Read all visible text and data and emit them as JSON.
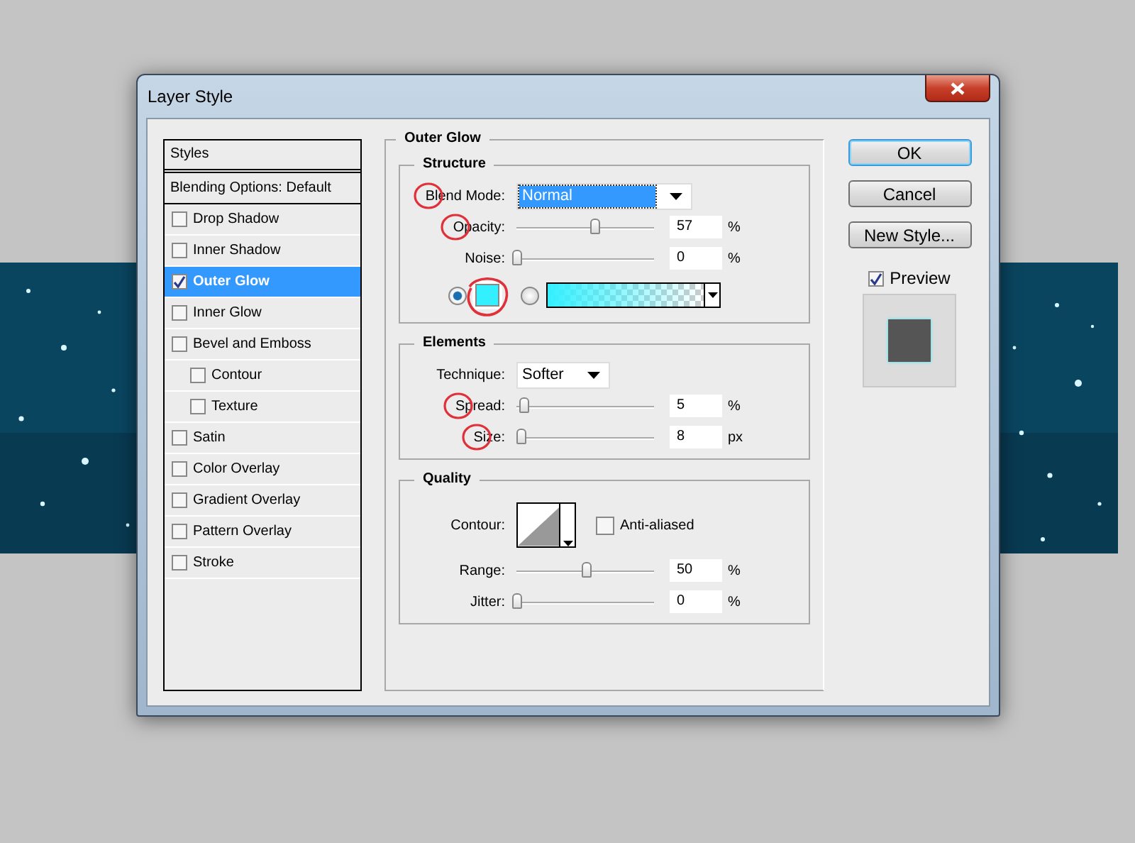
{
  "window": {
    "title": "Layer Style"
  },
  "styles_list": {
    "header": "Styles",
    "blending_options": "Blending Options: Default",
    "items": [
      {
        "label": "Drop Shadow",
        "checked": false,
        "selected": false
      },
      {
        "label": "Inner Shadow",
        "checked": false,
        "selected": false
      },
      {
        "label": "Outer Glow",
        "checked": true,
        "selected": true
      },
      {
        "label": "Inner Glow",
        "checked": false,
        "selected": false
      },
      {
        "label": "Bevel and Emboss",
        "checked": false,
        "selected": false,
        "children": [
          {
            "label": "Contour",
            "checked": false,
            "selected": false
          },
          {
            "label": "Texture",
            "checked": false,
            "selected": false
          }
        ]
      },
      {
        "label": "Satin",
        "checked": false,
        "selected": false
      },
      {
        "label": "Color Overlay",
        "checked": false,
        "selected": false
      },
      {
        "label": "Gradient Overlay",
        "checked": false,
        "selected": false
      },
      {
        "label": "Pattern Overlay",
        "checked": false,
        "selected": false
      },
      {
        "label": "Stroke",
        "checked": false,
        "selected": false
      }
    ]
  },
  "panel": {
    "title": "Outer Glow",
    "sections": [
      {
        "title": "Structure",
        "rows": [
          {
            "kind": "dropdown",
            "label": "Blend Mode:",
            "value": "Normal",
            "highlighted": true,
            "annotated": true
          },
          {
            "kind": "slider",
            "label": "Opacity:",
            "level": 0.57,
            "value": "57",
            "unit": "%",
            "annotated": true
          },
          {
            "kind": "slider",
            "label": "Noise:",
            "level": 0,
            "value": "0",
            "unit": "%"
          },
          {
            "kind": "fill",
            "options": [
              {
                "kind": "solid",
                "selected": true,
                "color": "#33f0ff",
                "annotated": true
              },
              {
                "kind": "gradient",
                "selected": false,
                "color": "#33f0ff"
              }
            ]
          }
        ]
      },
      {
        "title": "Elements",
        "rows": [
          {
            "kind": "dropdown",
            "label": "Technique:",
            "value": "Softer",
            "highlighted": false
          },
          {
            "kind": "slider",
            "label": "Spread:",
            "level": 0.05,
            "value": "5",
            "unit": "%",
            "annotated": true
          },
          {
            "kind": "slider",
            "label": "Size:",
            "level": 0.03,
            "value": "8",
            "unit": "px",
            "annotated": true
          }
        ]
      },
      {
        "title": "Quality",
        "rows": [
          {
            "kind": "contour",
            "label": "Contour:",
            "checkbox_label": "Anti-aliased",
            "checked": false
          },
          {
            "kind": "slider",
            "label": "Range:",
            "level": 0.5,
            "value": "50",
            "unit": "%"
          },
          {
            "kind": "slider",
            "label": "Jitter:",
            "level": 0,
            "value": "0",
            "unit": "%"
          }
        ]
      }
    ]
  },
  "buttons": [
    {
      "label": "OK",
      "default": true
    },
    {
      "label": "Cancel",
      "default": false
    },
    {
      "label": "New Style...",
      "default": false
    }
  ],
  "preview": {
    "label": "Preview",
    "checked": true
  }
}
